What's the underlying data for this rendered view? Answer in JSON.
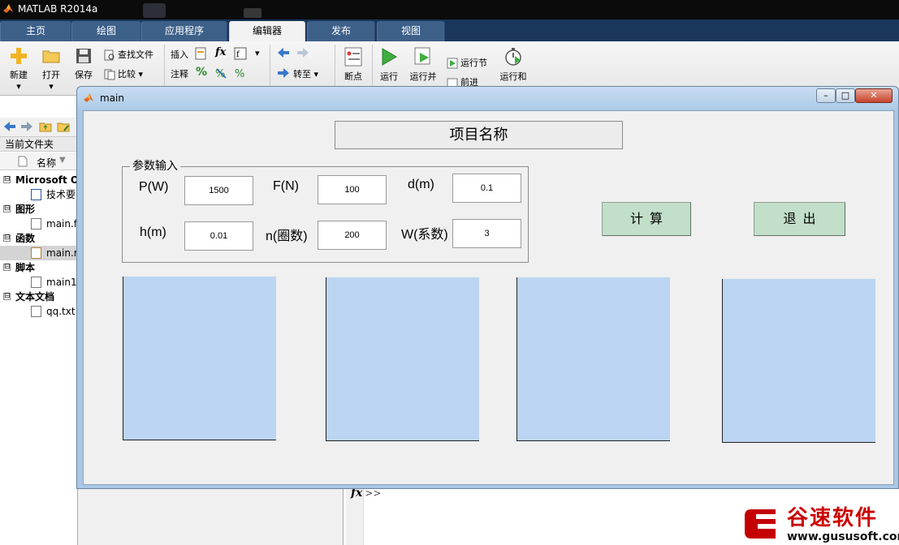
{
  "app": {
    "title": "MATLAB R2014a"
  },
  "tabs": [
    {
      "label": "主页"
    },
    {
      "label": "绘图"
    },
    {
      "label": "应用程序"
    },
    {
      "label": "编辑器"
    },
    {
      "label": "发布"
    },
    {
      "label": "视图"
    }
  ],
  "ribbon": {
    "new_label": "新建",
    "open_label": "打开",
    "save_label": "保存",
    "find_files_label": "查找文件",
    "compare_label": "比较",
    "insert_label": "插入",
    "fx_label": "fx",
    "comment_label": "注释",
    "percent_label": "%",
    "goto_label": "转至",
    "breakpoints_label": "断点",
    "run_label": "运行",
    "run_advance_label": "运行并",
    "run_section_label": "运行节",
    "advance_label": "前进",
    "run_time_label": "运行和"
  },
  "filebrowser": {
    "current_folder_label": "当前文件夹",
    "name_col_label": "名称",
    "rows": [
      {
        "kind": "group",
        "label": "Microsoft O"
      },
      {
        "kind": "file",
        "label": "技术要"
      },
      {
        "kind": "group",
        "label": "图形"
      },
      {
        "kind": "file",
        "label": "main.f"
      },
      {
        "kind": "group",
        "label": "函数"
      },
      {
        "kind": "file",
        "label": "main.r"
      },
      {
        "kind": "group",
        "label": "脚本"
      },
      {
        "kind": "file",
        "label": "main1"
      },
      {
        "kind": "group",
        "label": "文本文档"
      },
      {
        "kind": "file",
        "label": "qq.txt"
      }
    ],
    "expander_symbol": "⊟"
  },
  "figure": {
    "window_title": "main",
    "project_title": "项目名称",
    "params_panel_label": "参数输入",
    "params": {
      "p_label": "P(W)",
      "p_value": "1500",
      "f_label": "F(N)",
      "f_value": "100",
      "d_label": "d(m)",
      "d_value": "0.1",
      "h_label": "h(m)",
      "h_value": "0.01",
      "n_label": "n(圈数)",
      "n_value": "200",
      "w_label": "W(系数)",
      "w_value": "3"
    },
    "calc_button": "计算",
    "exit_button": "退出",
    "axes_count": 4,
    "axes_color": "#bbd5f2",
    "button_color": "#c2dfc9"
  },
  "command": {
    "prompt": "fx",
    "arrows": ">>"
  },
  "watermark": {
    "brand": "谷速软件",
    "url": "www.gususoft.com",
    "brand_color": "#cc0000"
  }
}
